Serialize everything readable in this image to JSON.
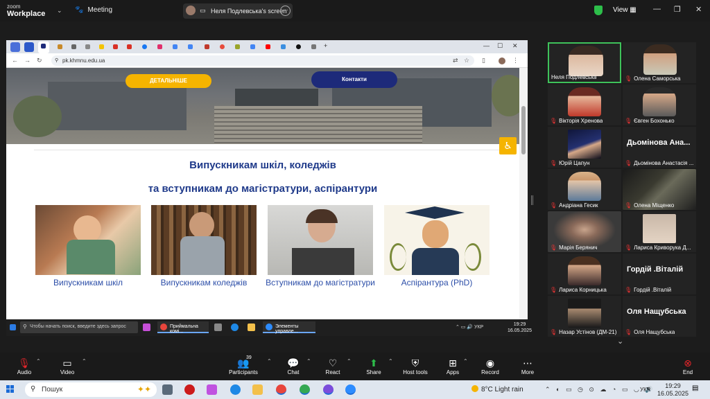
{
  "zoom": {
    "logo_top": "zoom",
    "logo_bottom": "Workplace",
    "meeting_label": "Meeting",
    "share_label": "Неля Подлевська's screen",
    "view_label": "View"
  },
  "browser": {
    "url": "pk.khmnu.edu.ua"
  },
  "website": {
    "btn_more": "ДЕТАЛЬНІШЕ",
    "btn_contacts": "Контакти",
    "heading_line1": "Випускникам шкіл, коледжів",
    "heading_line2": "та вступникам до магістратури, аспірантури",
    "cards": [
      {
        "caption": "Випускникам шкіл"
      },
      {
        "caption": "Випускникам коледжів"
      },
      {
        "caption": "Вступникам до магістратури"
      },
      {
        "caption": "Аспірантура (PhD)"
      }
    ]
  },
  "inner_taskbar": {
    "search_placeholder": "Чтобы начать поиск, введите здесь запрос",
    "app1": "Приймальна комі...",
    "app2": "Элементы управле...",
    "lang": "УКР",
    "time": "19:29",
    "date": "16.05.2025"
  },
  "participants": [
    {
      "name": "Неля Подлевська",
      "active": true
    },
    {
      "name": "Олена Саморська"
    },
    {
      "name": "Вікторія Хренова"
    },
    {
      "name": "Євген Бохонько"
    },
    {
      "name": "Юрій Цапун"
    },
    {
      "name": "Дьомінова Анастасія ...",
      "big": "Дьомінова Ана..."
    },
    {
      "name": "Андріана Гесик"
    },
    {
      "name": "Олена Міщенко"
    },
    {
      "name": "Марія Берянич"
    },
    {
      "name": "Лариса Криворука Д..."
    },
    {
      "name": "Лариса Корницька"
    },
    {
      "name": "Гордій .Віталій",
      "big": "Гордій .Віталій"
    },
    {
      "name": "Назар Устінов (ДМ-21)"
    },
    {
      "name": "Оля Нащубська",
      "big": "Оля Нащубська"
    }
  ],
  "toolbar": {
    "audio": "Audio",
    "video": "Video",
    "participants": "Participants",
    "participants_count": "39",
    "chat": "Chat",
    "react": "React",
    "share": "Share",
    "host_tools": "Host tools",
    "apps": "Apps",
    "record": "Record",
    "more": "More",
    "end": "End"
  },
  "taskbar": {
    "search_placeholder": "Пошук",
    "weather": "8°C  Light rain",
    "lang": "УКР",
    "time": "19:29",
    "date": "16.05.2025"
  },
  "colors": {
    "accent_yellow": "#f5b400",
    "accent_navy": "#1d2a7a",
    "heading_blue": "#1f3a8a",
    "zoom_green": "#2dbe4a",
    "zoom_red": "#e5252a"
  }
}
